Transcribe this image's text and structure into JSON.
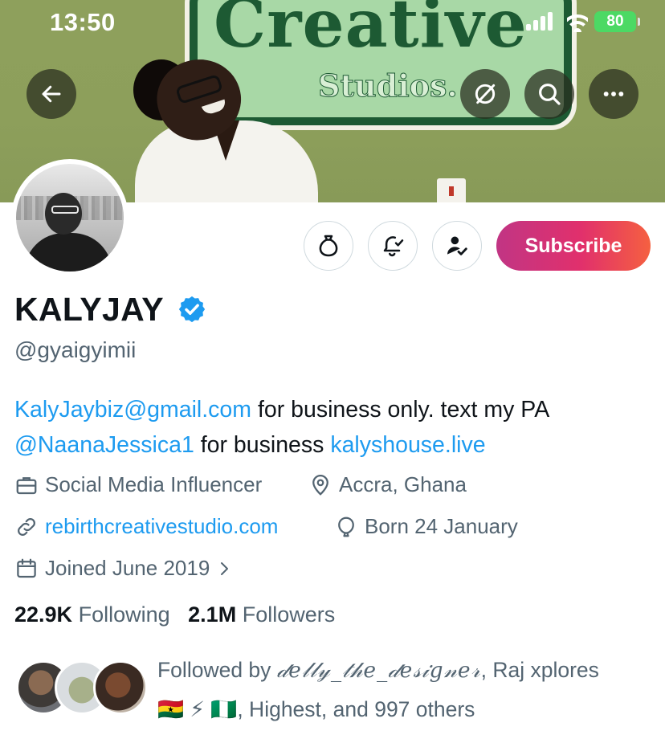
{
  "status_bar": {
    "time": "13:50",
    "battery": "80"
  },
  "banner": {
    "sign_title": "Creative",
    "sign_subtitle": "Studios."
  },
  "top_bar": {
    "back_icon": "arrow-left-icon",
    "grok_icon": "grok-icon",
    "search_icon": "search-icon",
    "more_icon": "more-icon"
  },
  "actions": {
    "tip_icon": "money-bag-icon",
    "notify_icon": "bell-plus-icon",
    "follow_icon": "following-user-icon",
    "subscribe_label": "Subscribe"
  },
  "profile": {
    "display_name": "KALYJAY",
    "handle": "@gyaigyimii",
    "bio": {
      "email": "KalyJaybiz@gmail.com",
      "text_1": " for business only. text my PA ",
      "mention": "@NaanaJessica1",
      "text_2": " for business ",
      "site": "kalyshouse.live"
    },
    "category": "Social Media Influencer",
    "location": "Accra, Ghana",
    "website": "rebirthcreativestudio.com",
    "birthday": "Born 24 January",
    "joined": "Joined June 2019"
  },
  "stats": {
    "following_count": "22.9K",
    "following_label": "Following",
    "followers_count": "2.1M",
    "followers_label": "Followers"
  },
  "followed_by": {
    "prefix": "Followed by ",
    "user_1": "𝒹𝑒𝓁𝓁𝓎_𝓉𝒽𝑒_𝒹𝑒𝓈𝒾𝑔𝓃𝑒𝓇",
    "sep": ", ",
    "user_2": "Raj xplores",
    "user_3": "🇬🇭 ⚡ 🇳🇬",
    "suffix": ", Highest, and 997 others"
  },
  "colors": {
    "accent": "#1d9bf0",
    "text": "#0f1419",
    "muted": "#536471",
    "verified": "#1d9bf0",
    "subscribe_gradient_start": "#c13584",
    "subscribe_gradient_end": "#f56040"
  }
}
